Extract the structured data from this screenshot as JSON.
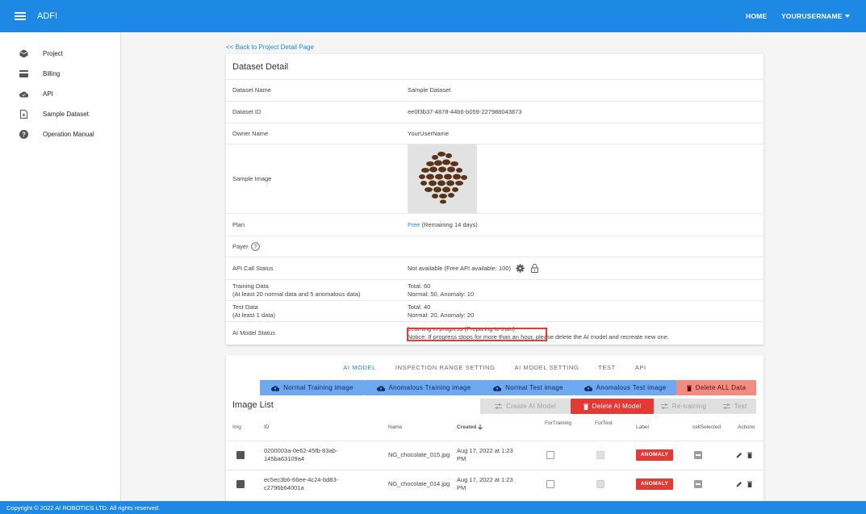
{
  "appbar": {
    "brand": "ADFI",
    "home": "HOME",
    "user": "YOURUSERNAME"
  },
  "sidebar": {
    "items": [
      {
        "label": "Project",
        "icon": "box-icon"
      },
      {
        "label": "Billing",
        "icon": "credit-card-icon"
      },
      {
        "label": "API",
        "icon": "cloud-icon"
      },
      {
        "label": "Sample Dataset",
        "icon": "file-icon"
      },
      {
        "label": "Operation Manual",
        "icon": "help-icon"
      }
    ]
  },
  "back_link": "<< Back to Project Detail Page",
  "detail": {
    "title": "Dataset Detail",
    "rows": {
      "name": {
        "label": "Dataset Name",
        "value": "Sample Dataset"
      },
      "id": {
        "label": "Dataset ID",
        "value": "ee0f3b37-4878-44b6-b059-227988043873"
      },
      "owner": {
        "label": "Owner Name",
        "value": "YourUserName"
      },
      "image": {
        "label": "Sample Image"
      },
      "plan": {
        "label": "Plan",
        "link": "Free",
        "rest": " (Remaining 14 days)"
      },
      "payer": {
        "label": "Payer"
      },
      "api": {
        "label": "API Call Status",
        "value": "Not available (Free API available: 100)"
      },
      "training": {
        "label": "Training Data",
        "sublabel": "(At least 20 normal data and 5 anomalous data)",
        "v1": "Total: 60",
        "v2": "Normal: 50, Anomaly: 10"
      },
      "test": {
        "label": "Test Data",
        "sublabel": "(At least 1 data)",
        "v1": "Total: 40",
        "v2": "Normal: 20, Anomaly: 20"
      },
      "model": {
        "label": "AI Model Status",
        "v1": "Learning in progress (Preparing to train)",
        "v2": "Notice: If progress stops for more than an hour, please delete the AI model and recreate new one."
      }
    }
  },
  "tabs": [
    "AI MODEL",
    "INSPECTION RANGE SETTING",
    "AI MODEL SETTING",
    "TEST",
    "API"
  ],
  "upload_buttons": {
    "normal_training": "Normal Training image",
    "anomalous_training": "Anomalous Training image",
    "normal_test": "Normal Test image",
    "anomalous_test": "Anomalous Test image",
    "delete_all": "Delete ALL Data"
  },
  "model_buttons": {
    "create": "Create AI Model",
    "delete": "Delete AI Model",
    "retrain": "Re-training",
    "test": "Test"
  },
  "image_list": {
    "title": "Image List",
    "headers": {
      "img": "Img",
      "id": "ID",
      "name": "Name",
      "created": "Created",
      "for_training": "ForTraining",
      "for_test": "ForTest",
      "label": "Label",
      "cell_selected": "cellSelected",
      "actions": "Actions"
    },
    "rows": [
      {
        "id1": "0200003a-0e62-45fb-83ab-",
        "id2": "145ba63109a4",
        "name": "NG_chocolate_015.jpg",
        "created1": "Aug 17, 2022 at 1:23",
        "created2": "PM",
        "label": "ANOMALY"
      },
      {
        "id1": "ec5ec3b6-66ee-4c24-bd83-",
        "id2": "c2796b64001a",
        "name": "NG_chocolate_014.jpg",
        "created1": "Aug 17, 2022 at 1:23",
        "created2": "PM",
        "label": "ANOMALY"
      }
    ]
  },
  "footer": "Copyright © 2022 AI ROBOTICS LTD. All rights reserved.",
  "colors": {
    "primary": "#1e88e5",
    "danger": "#e53935",
    "upload_blue": "#6ea8f0",
    "delete_light": "#f28b82"
  }
}
